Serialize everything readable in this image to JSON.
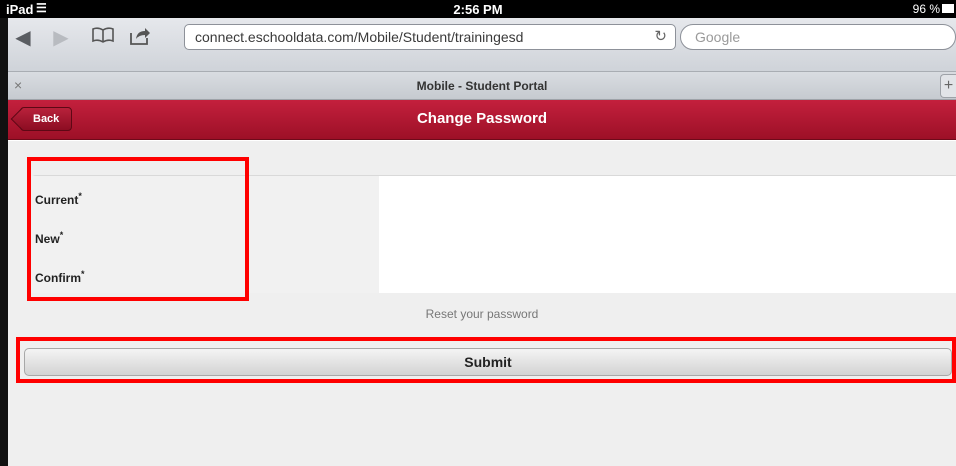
{
  "status_bar": {
    "carrier": "iPad",
    "time": "2:56 PM",
    "battery": "96 %"
  },
  "browser": {
    "url": "connect.eschooldata.com/Mobile/Student/trainingesd",
    "search_placeholder": "Google",
    "tab_title": "Mobile - Student Portal",
    "tab_close": "×",
    "tab_add": "+"
  },
  "header": {
    "back_label": "Back",
    "title": "Change Password"
  },
  "form": {
    "fields": [
      {
        "label": "Current",
        "required": "*",
        "value": ""
      },
      {
        "label": "New",
        "required": "*",
        "value": ""
      },
      {
        "label": "Confirm",
        "required": "*",
        "value": ""
      }
    ],
    "hint": "Reset your password",
    "submit_label": "Submit"
  },
  "colors": {
    "header_bg": "#b0172f",
    "highlight": "#ff0000",
    "content_bg": "#efefef"
  }
}
